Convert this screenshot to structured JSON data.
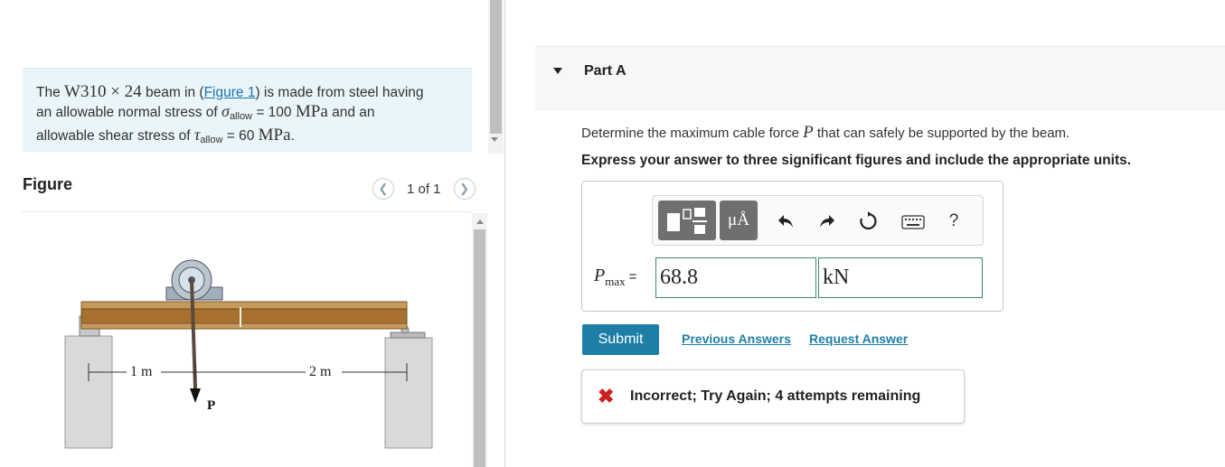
{
  "problem": {
    "t1": "The ",
    "beam": "W310 × 24",
    "t2": " beam in (",
    "figure_link": "Figure 1",
    "t3": ") is made from steel having",
    "t4": "an allowable normal stress of ",
    "sigma": "σ",
    "sigma_sub": "allow",
    "t5": " = 100 ",
    "mpa1": "MPa",
    "t6": " and an",
    "t7": "allowable shear stress of ",
    "tau": "τ",
    "tau_sub": "allow",
    "t8": " = 60 ",
    "mpa2": "MPa",
    "t9": "."
  },
  "figure": {
    "title": "Figure",
    "counter": "1 of 1",
    "prev_icon": "chevron-left-icon",
    "next_icon": "chevron-right-icon",
    "label_1m": "1 m",
    "label_2m": "2 m",
    "label_p": "P"
  },
  "part": {
    "title": "Part A",
    "q1": "Determine the maximum cable force ",
    "q_sym": "P",
    "q2": " that can safely be supported by the beam.",
    "instruction": "Express your answer to three significant figures and include the appropriate units."
  },
  "toolbar": {
    "units_label": "μÅ",
    "icons": [
      "templates-icon",
      "units-icon",
      "undo-icon",
      "redo-icon",
      "reset-icon",
      "keyboard-icon",
      "help-icon"
    ],
    "help_label": "?"
  },
  "answer": {
    "label_main": "P",
    "label_sub": "max",
    "equals": "=",
    "value": "68.8",
    "unit": "kN"
  },
  "actions": {
    "submit": "Submit",
    "previous": "Previous Answers",
    "request": "Request Answer"
  },
  "feedback": {
    "text": "Incorrect; Try Again; 4 attempts remaining",
    "icon": "x-icon"
  },
  "colors": {
    "accent": "#1e7fa6",
    "error": "#cc1f1f",
    "problem_bg": "#e9f5f8",
    "field_border": "#3a8a6a"
  }
}
